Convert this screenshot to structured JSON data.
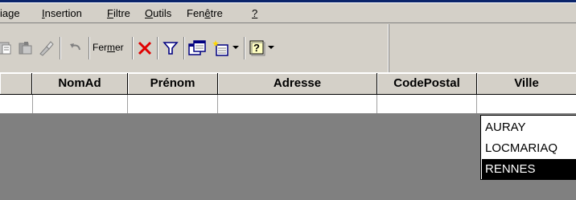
{
  "menu": {
    "items": [
      {
        "pre": "",
        "mn": "",
        "post": "iage"
      },
      {
        "pre": "",
        "mn": "I",
        "post": "nsertion"
      },
      {
        "pre": "",
        "mn": "F",
        "post": "iltre"
      },
      {
        "pre": "",
        "mn": "O",
        "post": "utils"
      },
      {
        "pre": "Fen",
        "mn": "ê",
        "post": "tre"
      },
      {
        "pre": "",
        "mn": "?",
        "post": ""
      }
    ]
  },
  "toolbar": {
    "close": {
      "pre": "Fer",
      "mn": "m",
      "post": "er"
    },
    "icons": [
      "paste-icon",
      "format-painter-icon",
      "brush-icon",
      "undo-icon",
      "delete-icon",
      "filter-icon",
      "database-window-icon",
      "new-object-icon",
      "help-icon"
    ]
  },
  "grid": {
    "columns": [
      "NomAd",
      "Prénom",
      "Adresse",
      "CodePostal",
      "Ville"
    ]
  },
  "dropdown": {
    "options": [
      "AURAY",
      "LOCMARIAQ",
      "RENNES"
    ],
    "selected": "RENNES"
  },
  "colors": {
    "face": "#d4d0c8",
    "shadow": "#808080",
    "title_bar": "#0a246a"
  }
}
